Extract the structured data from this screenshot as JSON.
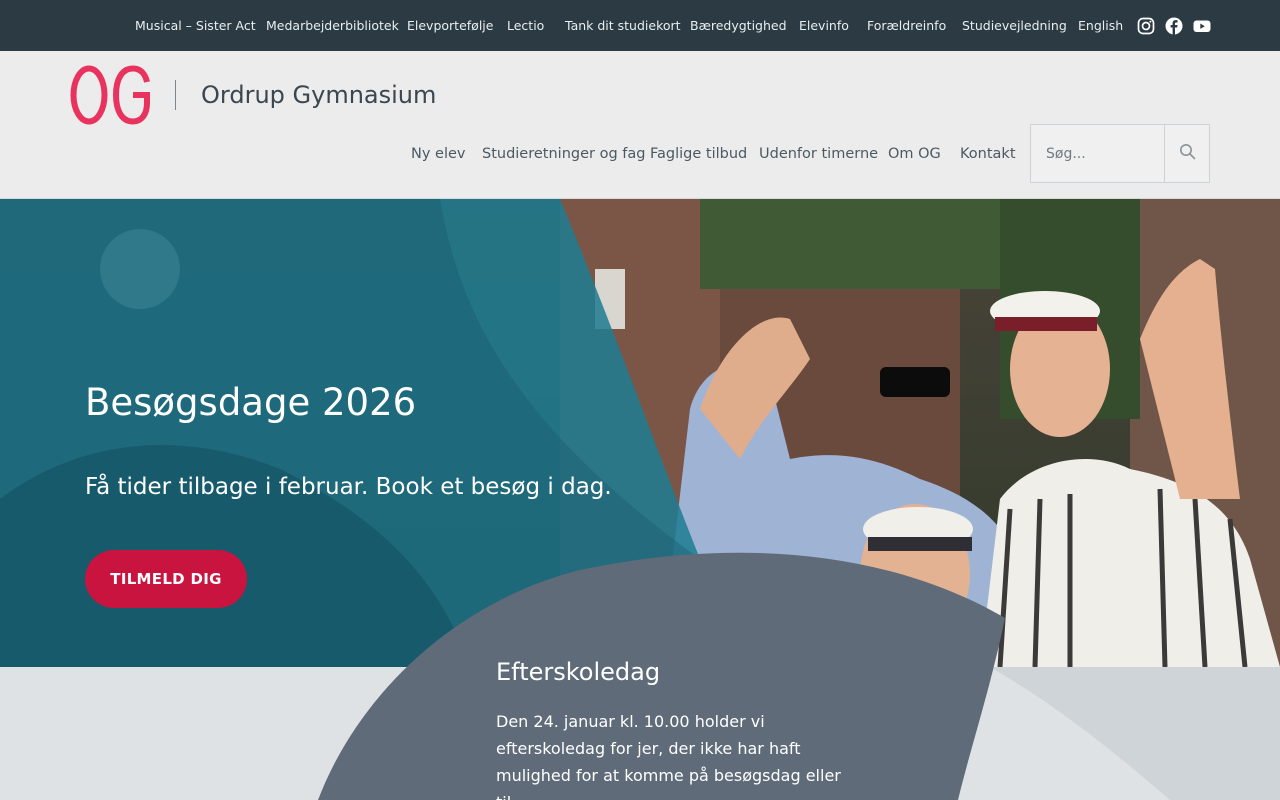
{
  "topbar": {
    "links": [
      "Musical – Sister Act",
      "Medarbejderbibliotek",
      "Elevportefølje",
      "Lectio",
      "Tank dit studiekort",
      "Bæredygtighed",
      "Elevinfo",
      "Forældreinfo",
      "Studievejledning",
      "English"
    ],
    "social": [
      "instagram-icon",
      "facebook-icon",
      "youtube-icon"
    ]
  },
  "header": {
    "logo_text": "OG",
    "site_name": "Ordrup Gymnasium",
    "nav": [
      "Ny elev",
      "Studieretninger og fag",
      "Faglige tilbud",
      "Udenfor timerne",
      "Om OG",
      "Kontakt"
    ],
    "search_placeholder": "Søg...",
    "search_icon": "search-icon"
  },
  "hero": {
    "title": "Besøgsdage 2026",
    "subtitle": "Få tider tilbage i februar. Book et besøg i dag.",
    "button_label": "TILMELD DIG"
  },
  "card": {
    "title": "Efterskoledag",
    "text": "Den 24. januar kl. 10.00 holder vi efterskoledag for jer, der ikke har haft mulighed for at komme på besøgsdag eller til"
  },
  "colors": {
    "topbar_bg": "#2b3a43",
    "brand_red": "#c8143f",
    "logo_pink": "#e8335f",
    "teal_overlay": "#1e7d92",
    "slate_shape": "#5f6b78"
  }
}
